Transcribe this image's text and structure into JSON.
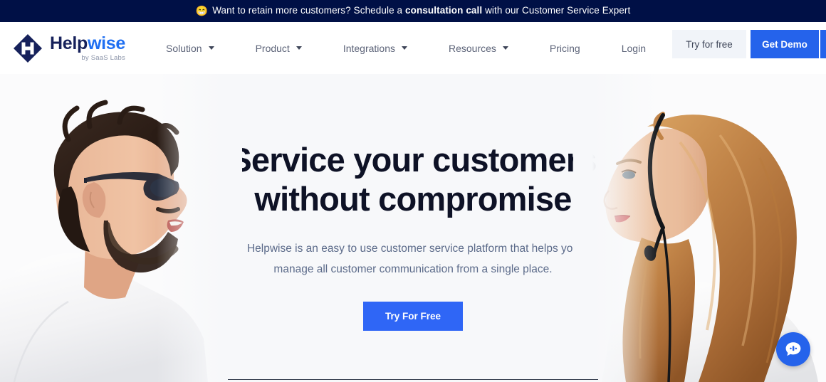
{
  "announcement": {
    "emoji": "😁",
    "text_before": "Want to retain more customers? Schedule a ",
    "highlight": "consultation call",
    "text_after": " with our Customer Service Expert",
    "background_color": "#001046",
    "text_color": "#FFFFFF"
  },
  "header": {
    "logo": {
      "name_part1": "Help",
      "name_part2": "wise",
      "tagline": "by SaaS Labs",
      "mark_color": "#16215B",
      "accent_color": "#1F6FF2"
    },
    "nav": [
      {
        "label": "Solution",
        "has_dropdown": true
      },
      {
        "label": "Product",
        "has_dropdown": true
      },
      {
        "label": "Integrations",
        "has_dropdown": true
      },
      {
        "label": "Resources",
        "has_dropdown": true
      },
      {
        "label": "Pricing",
        "has_dropdown": false
      },
      {
        "label": "Login",
        "has_dropdown": false
      }
    ],
    "try_free_label": "Try for free",
    "get_demo_label": "Get Demo",
    "get_demo_color": "#2563EB"
  },
  "hero": {
    "title_line1": "Service your customers",
    "title_line2": "without compromise",
    "subtitle_line1": "Helpwise is an easy to use customer service platform that helps you",
    "subtitle_line2": "manage all customer communication from a single place.",
    "cta_label": "Try For Free",
    "cta_color": "#2F66F6",
    "background_color": "#F7F8FA",
    "left_image_alt": "Smiling bearded man with glasses in profile wearing a white t-shirt",
    "right_image_alt": "Woman with long strawberry blonde hair wearing a headset in profile"
  },
  "chat": {
    "icon": "chat-bubble-icon",
    "color": "#2563EB"
  }
}
